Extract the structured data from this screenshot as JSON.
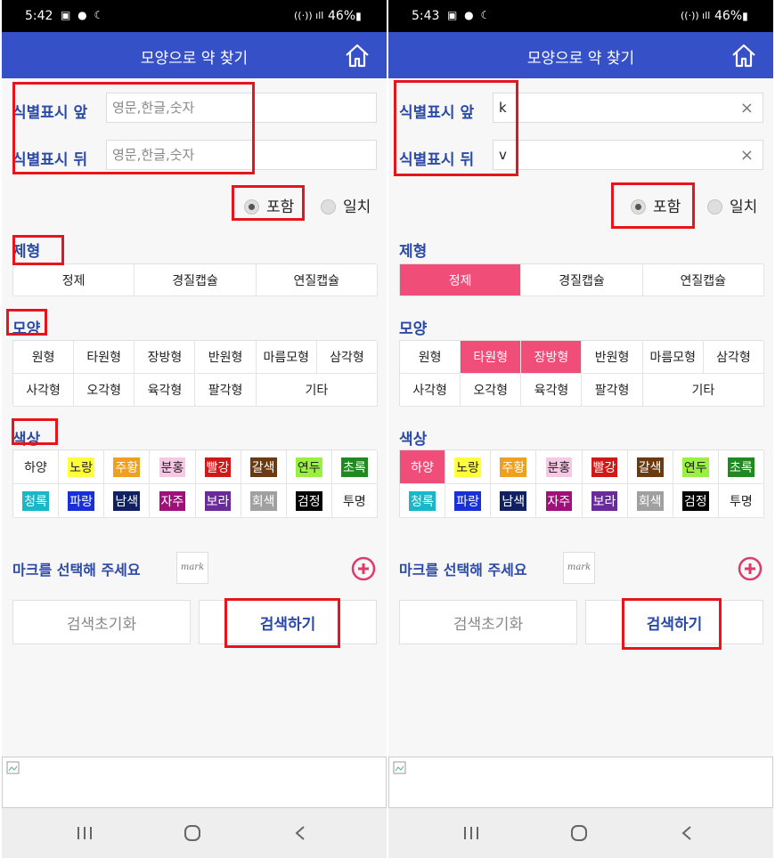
{
  "screens": [
    {
      "status": {
        "time": "5:42",
        "battery": "46%"
      },
      "title": "모양으로 약 찾기",
      "front_label": "식별표시 앞",
      "back_label": "식별표시 뒤",
      "front_value": "",
      "back_value": "",
      "placeholder": "영문,한글,숫자",
      "match_contains": "포함",
      "match_exact": "일치",
      "form_title": "제형",
      "forms": [
        {
          "label": "정제",
          "selected": false
        },
        {
          "label": "경질캡슐",
          "selected": false
        },
        {
          "label": "연질캡슐",
          "selected": false
        }
      ],
      "shape_title": "모양",
      "shapes": [
        {
          "label": "원형",
          "selected": false
        },
        {
          "label": "타원형",
          "selected": false
        },
        {
          "label": "장방형",
          "selected": false
        },
        {
          "label": "반원형",
          "selected": false
        },
        {
          "label": "마름모형",
          "selected": false
        },
        {
          "label": "삼각형",
          "selected": false
        },
        {
          "label": "사각형",
          "selected": false
        },
        {
          "label": "오각형",
          "selected": false
        },
        {
          "label": "육각형",
          "selected": false
        },
        {
          "label": "팔각형",
          "selected": false
        },
        {
          "label": "기타",
          "selected": false
        }
      ],
      "color_title": "색상",
      "colors": [
        {
          "label": "하양",
          "selected": false
        },
        {
          "label": "노랑",
          "selected": false
        },
        {
          "label": "주황",
          "selected": false
        },
        {
          "label": "분홍",
          "selected": false
        },
        {
          "label": "빨강",
          "selected": false
        },
        {
          "label": "갈색",
          "selected": false
        },
        {
          "label": "연두",
          "selected": false
        },
        {
          "label": "초록",
          "selected": false
        },
        {
          "label": "청록",
          "selected": false
        },
        {
          "label": "파랑",
          "selected": false
        },
        {
          "label": "남색",
          "selected": false
        },
        {
          "label": "자주",
          "selected": false
        },
        {
          "label": "보라",
          "selected": false
        },
        {
          "label": "회색",
          "selected": false
        },
        {
          "label": "검정",
          "selected": false
        },
        {
          "label": "투명",
          "selected": false
        }
      ],
      "mark_prompt": "마크를 선택해 주세요",
      "mark_text": "mark",
      "reset_label": "검색초기화",
      "search_label": "검색하기"
    },
    {
      "status": {
        "time": "5:43",
        "battery": "46%"
      },
      "title": "모양으로 약 찾기",
      "front_label": "식별표시 앞",
      "back_label": "식별표시 뒤",
      "front_value": "k",
      "back_value": "v",
      "placeholder": "영문,한글,숫자",
      "match_contains": "포함",
      "match_exact": "일치",
      "form_title": "제형",
      "forms": [
        {
          "label": "정제",
          "selected": true
        },
        {
          "label": "경질캡슐",
          "selected": false
        },
        {
          "label": "연질캡슐",
          "selected": false
        }
      ],
      "shape_title": "모양",
      "shapes": [
        {
          "label": "원형",
          "selected": false
        },
        {
          "label": "타원형",
          "selected": true
        },
        {
          "label": "장방형",
          "selected": true
        },
        {
          "label": "반원형",
          "selected": false
        },
        {
          "label": "마름모형",
          "selected": false
        },
        {
          "label": "삼각형",
          "selected": false
        },
        {
          "label": "사각형",
          "selected": false
        },
        {
          "label": "오각형",
          "selected": false
        },
        {
          "label": "육각형",
          "selected": false
        },
        {
          "label": "팔각형",
          "selected": false
        },
        {
          "label": "기타",
          "selected": false
        }
      ],
      "color_title": "색상",
      "colors": [
        {
          "label": "하양",
          "selected": true
        },
        {
          "label": "노랑",
          "selected": false
        },
        {
          "label": "주황",
          "selected": false
        },
        {
          "label": "분홍",
          "selected": false
        },
        {
          "label": "빨강",
          "selected": false
        },
        {
          "label": "갈색",
          "selected": false
        },
        {
          "label": "연두",
          "selected": false
        },
        {
          "label": "초록",
          "selected": false
        },
        {
          "label": "청록",
          "selected": false
        },
        {
          "label": "파랑",
          "selected": false
        },
        {
          "label": "남색",
          "selected": false
        },
        {
          "label": "자주",
          "selected": false
        },
        {
          "label": "보라",
          "selected": false
        },
        {
          "label": "회색",
          "selected": false
        },
        {
          "label": "검정",
          "selected": false
        },
        {
          "label": "투명",
          "selected": false
        }
      ],
      "mark_prompt": "마크를 선택해 주세요",
      "mark_text": "mark",
      "reset_label": "검색초기화",
      "search_label": "검색하기"
    }
  ],
  "color_swatches": {
    "하양": {
      "bg": "transparent",
      "fg": "#222222"
    },
    "노랑": {
      "bg": "#ffff3c",
      "fg": "#222222"
    },
    "주황": {
      "bg": "#f0a020",
      "fg": "#ffffff"
    },
    "분홍": {
      "bg": "#f6c8e6",
      "fg": "#222222"
    },
    "빨강": {
      "bg": "#d01818",
      "fg": "#ffffff"
    },
    "갈색": {
      "bg": "#6a3a10",
      "fg": "#ffffff"
    },
    "연두": {
      "bg": "#9af040",
      "fg": "#222222"
    },
    "초록": {
      "bg": "#1e8a20",
      "fg": "#ffffff"
    },
    "청록": {
      "bg": "#18b8c8",
      "fg": "#ffffff"
    },
    "파랑": {
      "bg": "#1830d8",
      "fg": "#ffffff"
    },
    "남색": {
      "bg": "#102060",
      "fg": "#ffffff"
    },
    "자주": {
      "bg": "#a0107a",
      "fg": "#ffffff"
    },
    "보라": {
      "bg": "#6a2a9a",
      "fg": "#ffffff"
    },
    "회색": {
      "bg": "#a0a0a0",
      "fg": "#ffffff"
    },
    "검정": {
      "bg": "#000000",
      "fg": "#ffffff"
    },
    "투명": {
      "bg": "transparent",
      "fg": "#222222"
    }
  },
  "theme": {
    "header": "#3650c8",
    "accent": "#2b4aa6",
    "selected": "#f04d79",
    "highlight": "#e8141c"
  },
  "icons": {
    "home": "home-icon",
    "add": "plus-circle-icon",
    "recent": "recent-apps-icon",
    "homebtn": "home-button-icon",
    "back": "back-icon"
  }
}
